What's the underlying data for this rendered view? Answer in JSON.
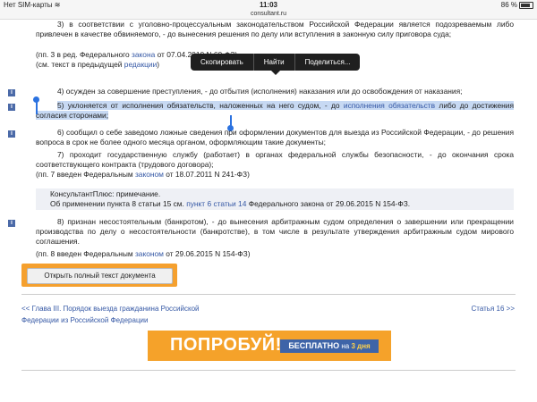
{
  "status_bar": {
    "carrier": "Нет SIM-карты",
    "wifi_icon": "wifi-icon",
    "time": "11:03",
    "battery": "86 %"
  },
  "url": "consultant.ru",
  "content": {
    "item3_text": "3) в соответствии с уголовно-процессуальным законодательством Российской Федерации является подозреваемым либо привлечен в качестве обвиняемого, - до вынесения решения по делу или вступления в законную силу приговора суда;",
    "item3_note_pre": "(пп. 3 в ред. Федерального",
    "item3_note_link": "закона",
    "item3_note_post": "от 07.04.2010 N 60-ФЗ)",
    "item3_prev_pre": "(см. текст в предыдущей",
    "item3_prev_link": "редакции",
    "item3_prev_post": ")",
    "item4_text": "4) осужден за совершение преступления, - до отбытия (исполнения) наказания или до освобождения от наказания;",
    "item5_pre": "5) уклоняется от исполнения обязательств, наложенных на него судом, - до ",
    "item5_link": "исполнения обязательств",
    "item5_post": " либо до достижения согласия сторонами;",
    "item6_text": "6) сообщил о себе заведомо ложные сведения при оформлении документов для выезда из Российской Федерации, - до решения вопроса в срок не более одного месяца органом, оформляющим такие документы;",
    "item7_text": "7) проходит государственную службу (работает) в органах федеральной службы безопасности, - до окончания срока соответствующего контракта (трудового договора);",
    "item7_note_pre": "(пп. 7 введен Федеральным",
    "item7_note_link": "законом",
    "item7_note_post": "от 18.07.2011 N 241-ФЗ)",
    "note_title": "КонсультантПлюс: примечание.",
    "note_pre": "Об применении пункта 8 статьи 15 см.",
    "note_link": "пункт 6 статьи 14",
    "note_post": "Федерального закона от 29.06.2015 N 154-ФЗ.",
    "item8_text": "8) признан несостоятельным (банкротом), - до вынесения арбитражным судом определения о завершении или прекращении производства по делу о несостоятельности (банкротстве), в том числе в результате утверждения арбитражным судом мирового соглашения.",
    "item8_note_pre": "(пп. 8 введен Федеральным",
    "item8_note_link": "законом",
    "item8_note_post": "от 29.06.2015 N 154-ФЗ)",
    "info_marker": "i"
  },
  "context_menu": {
    "copy": "Скопировать",
    "find": "Найти",
    "share": "Поделиться..."
  },
  "open_full_button": "Открыть полный текст документа",
  "nav": {
    "prev": "<< Глава III. Порядок выезда гражданина Российской Федерации из Российской Федерации",
    "next": "Статья 16 >>"
  },
  "banner": {
    "title": "ПОПРОБУЙ!",
    "badge_pre": "БЕСПЛАТНО",
    "badge_mid": " на ",
    "badge_days": "3 дня"
  },
  "colors": {
    "accent_orange": "#f5a22a",
    "link_blue": "#3558a5",
    "selection": "#c7d9f3",
    "info_blue": "#4b6aa8"
  }
}
